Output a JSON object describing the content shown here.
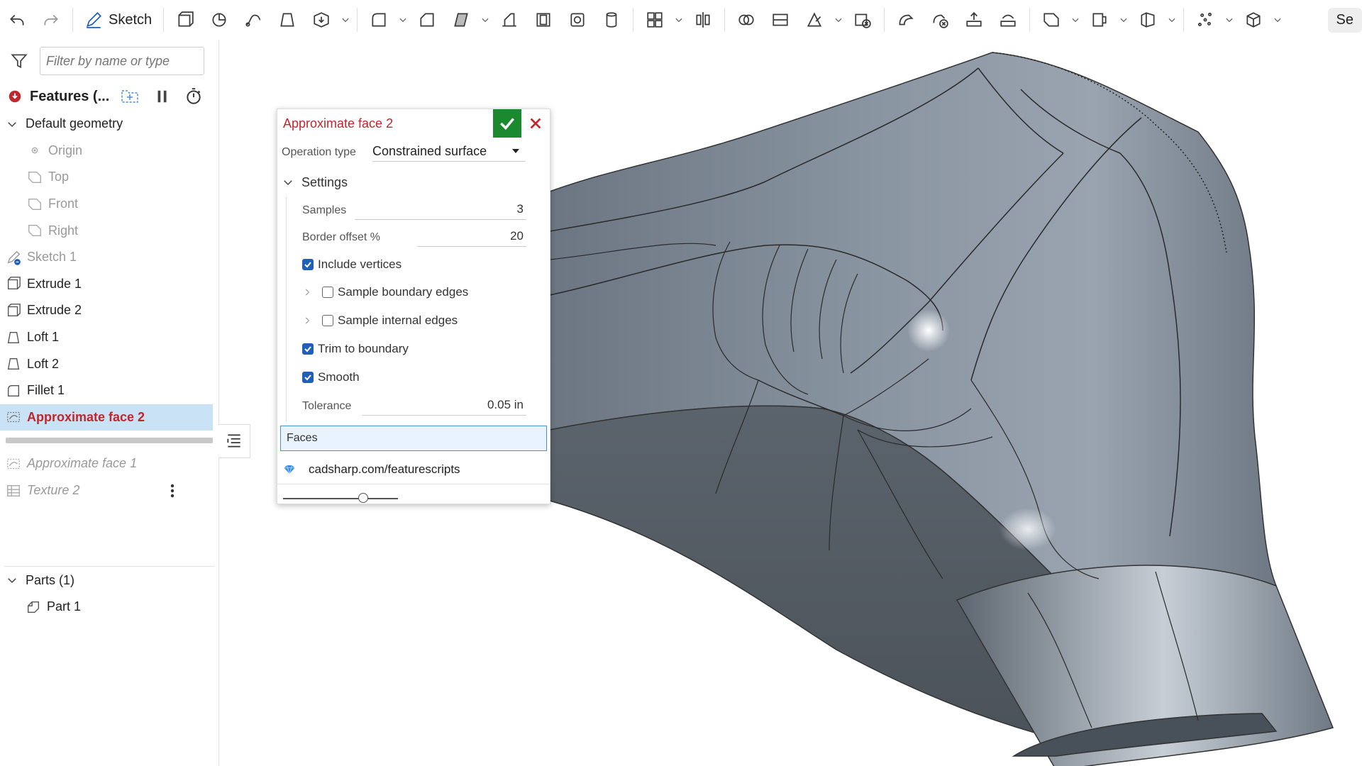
{
  "toolbar": {
    "sketch_label": "Sketch",
    "truncated_label": "Se"
  },
  "sidebar": {
    "filter_placeholder": "Filter by name or type",
    "features_header": "Features (...",
    "default_geometry_label": "Default geometry",
    "default_geometry": [
      "Origin",
      "Top",
      "Front",
      "Right"
    ],
    "features": [
      {
        "label": "Sketch 1",
        "icon": "sketch-icon",
        "state": "dimmed"
      },
      {
        "label": "Extrude 1",
        "icon": "extrude-icon",
        "state": "normal"
      },
      {
        "label": "Extrude 2",
        "icon": "extrude-icon",
        "state": "normal"
      },
      {
        "label": "Loft 1",
        "icon": "loft-icon",
        "state": "normal"
      },
      {
        "label": "Loft 2",
        "icon": "loft-icon",
        "state": "normal"
      },
      {
        "label": "Fillet 1",
        "icon": "fillet-icon",
        "state": "normal"
      },
      {
        "label": "Approximate face 2",
        "icon": "approximate-face-icon",
        "state": "selected"
      }
    ],
    "rolled_back": [
      {
        "label": "Approximate face 1",
        "icon": "approximate-face-icon"
      },
      {
        "label": "Texture 2",
        "icon": "texture-icon"
      }
    ],
    "parts_header": "Parts (1)",
    "parts": [
      "Part 1"
    ]
  },
  "dialog": {
    "title": "Approximate face 2",
    "operation_type_label": "Operation type",
    "operation_type_value": "Constrained surface",
    "settings_label": "Settings",
    "samples_label": "Samples",
    "samples_value": "3",
    "border_offset_label": "Border offset %",
    "border_offset_value": "20",
    "include_vertices_label": "Include vertices",
    "include_vertices_checked": true,
    "sample_boundary_label": "Sample boundary edges",
    "sample_boundary_checked": false,
    "sample_internal_label": "Sample internal edges",
    "sample_internal_checked": false,
    "trim_label": "Trim to boundary",
    "trim_checked": true,
    "smooth_label": "Smooth",
    "smooth_checked": true,
    "tolerance_label": "Tolerance",
    "tolerance_value": "0.05 in",
    "faces_label": "Faces",
    "link_text": "cadsharp.com/featurescripts",
    "slider_fraction": 0.7
  },
  "colors": {
    "accent_red": "#c0272d",
    "ok_green": "#1b8a2f",
    "checkbox_blue": "#1f5fb5",
    "selection_blue": "#c9e2f6"
  }
}
